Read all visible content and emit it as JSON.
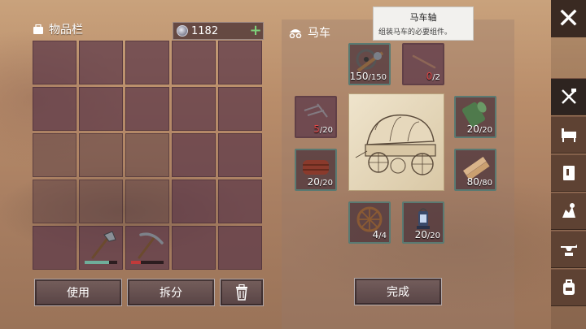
{
  "inventory": {
    "title": "物品栏",
    "currency": "1182",
    "add_label": "+",
    "use_label": "使用",
    "split_label": "拆分",
    "tools": [
      {
        "icon": "axe-icon",
        "durability": 0.75,
        "bar_color": "#6fae9a"
      },
      {
        "icon": "pickaxe-icon",
        "durability": 0.3,
        "bar_color": "#c23a3a"
      }
    ]
  },
  "wagon": {
    "title": "马车",
    "complete_label": "完成",
    "parts": [
      {
        "icon": "wagon-axle-icon",
        "have": "150",
        "need": "/150",
        "shortage": false
      },
      {
        "icon": "wooden-stick-icon",
        "have": "0",
        "need": "/2",
        "shortage": true
      },
      {
        "icon": "nails-icon",
        "have": "5",
        "need": "/20",
        "shortage": true
      },
      {
        "icon": "cloth-roll-icon",
        "have": "20",
        "need": "/20",
        "shortage": false
      },
      {
        "icon": "leather-icon",
        "have": "20",
        "need": "/20",
        "shortage": false
      },
      {
        "icon": "planks-icon",
        "have": "80",
        "need": "/80",
        "shortage": false
      },
      {
        "icon": "wheel-icon",
        "have": "4",
        "need": "/4",
        "shortage": false
      },
      {
        "icon": "lantern-icon",
        "have": "20",
        "need": "/20",
        "shortage": false
      }
    ]
  },
  "tooltip": {
    "title": "马车轴",
    "description": "组装马车的必要组件。"
  },
  "sidebar": {
    "close_label": "✕",
    "tabs": [
      "crafting-tools-icon",
      "furniture-icon",
      "book-icon",
      "resources-icon",
      "anvil-icon",
      "backpack-icon"
    ]
  },
  "colors": {
    "slot": "#5c3748",
    "accent_green": "#7ed07a",
    "shortage_red": "#e04848",
    "part_border": "#5a7a72"
  }
}
